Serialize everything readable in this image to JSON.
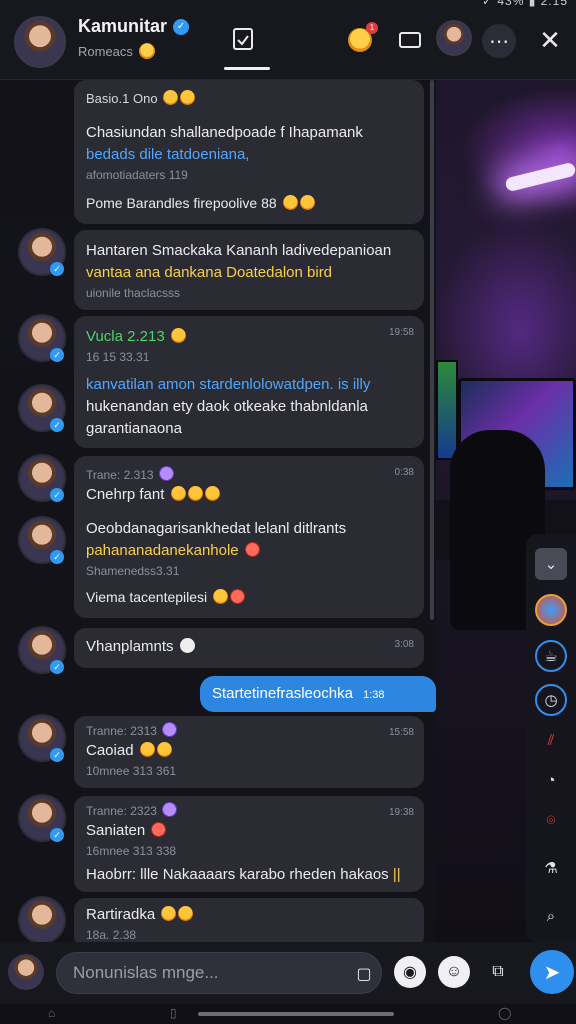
{
  "header": {
    "title": "Kamunitar",
    "subtitle": "Romeacs",
    "status_text": "✓ 43% ▮ 2:15",
    "notify_badge": "1"
  },
  "messages": [
    {
      "meta_top": "Basio.1 Ono",
      "lines": [
        "Chasiundan shallanedpoade f Ihapamank",
        "bedads dile tatdoeniana,"
      ],
      "meta": "afomotiadaters 119",
      "extra": "Pome Barandles firepoolive 88"
    },
    {
      "lines": [
        "Hantaren Smackaka Kananh ladivedepanioan",
        "vantaa ana dankana Doatedalon bird"
      ],
      "meta": "uionile thaclacsss"
    },
    {
      "name": "Vucla 2.213",
      "time": "19:58",
      "meta": "16 15 33.31",
      "lines": [
        "kanvatilan amon stardenlolowatdpen. is illy",
        "hukenandan ety daok otkeake thabnldanla",
        "garantianaona"
      ]
    },
    {
      "name": "Trane: 2.313",
      "time": "0:38",
      "sub": "Cnehrp fant",
      "lines": [
        "Oeobdanagarisankhedat lelanl ditlrants",
        "pahananadanekanhole"
      ],
      "meta": "Shamenedss3.31",
      "extra": "Viema tacentepilesi"
    },
    {
      "name": "Vhanplamnts",
      "time": "3:08"
    },
    {
      "name": "Tranne: 2313",
      "time": "15:58",
      "sub": "Caoiad",
      "meta": "10mnee 313 361"
    },
    {
      "name": "Tranne: 2323",
      "time": "19:38",
      "sub": "Saniaten",
      "meta": "16mnee 313 338",
      "lines": [
        "Haobrr: llle Nakaaaars karabo rheden hakaos"
      ]
    },
    {
      "sub": "Rartiradka",
      "meta": "18a. 2.38"
    }
  ],
  "own_message": {
    "text": "Startetinefrasleochka",
    "time": "1:38"
  },
  "input": {
    "placeholder": "Nonunislas mnge..."
  },
  "colors": {
    "accent": "#2f8fef",
    "bubble": "#2a2b33",
    "header": "#17171e"
  }
}
